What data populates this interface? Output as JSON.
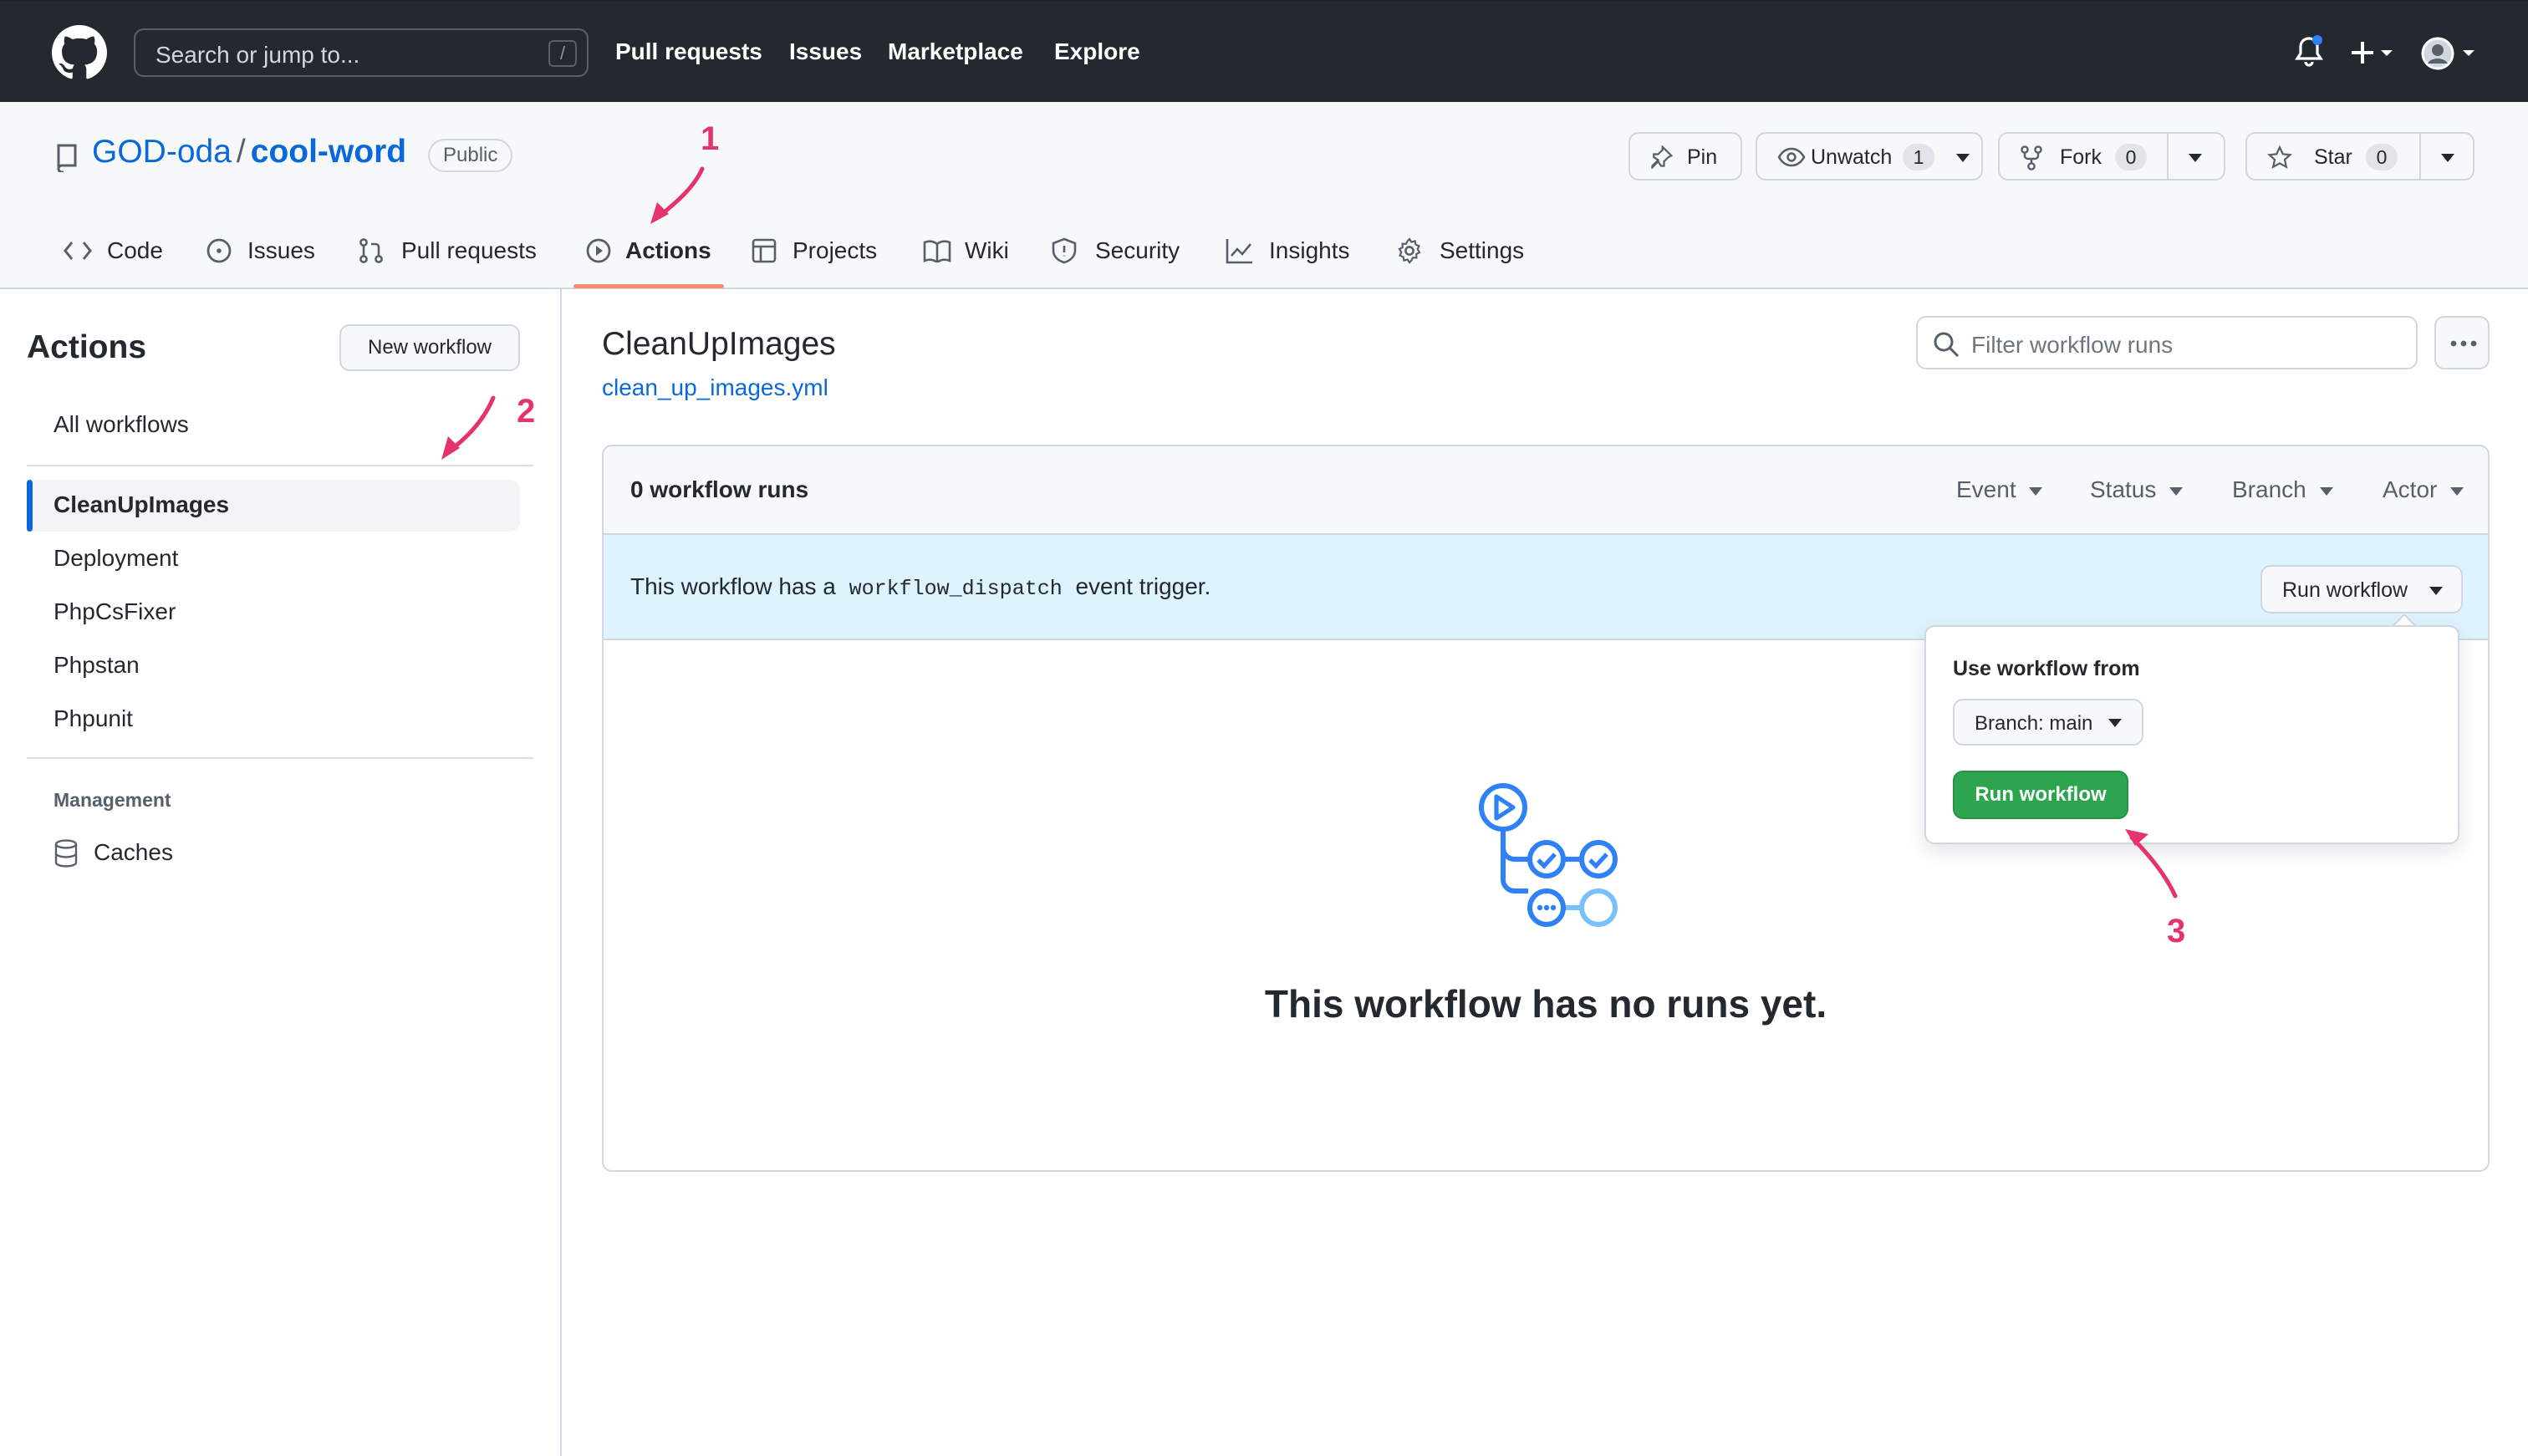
{
  "header": {
    "search_placeholder": "Search or jump to...",
    "search_shortcut": "/",
    "nav": [
      "Pull requests",
      "Issues",
      "Marketplace",
      "Explore"
    ]
  },
  "repo": {
    "owner": "GOD-oda",
    "separator": "/",
    "name": "cool-word",
    "visibility": "Public",
    "pin_label": "Pin",
    "unwatch_label": "Unwatch",
    "unwatch_count": "1",
    "fork_label": "Fork",
    "fork_count": "0",
    "star_label": "Star",
    "star_count": "0",
    "tabs": [
      "Code",
      "Issues",
      "Pull requests",
      "Actions",
      "Projects",
      "Wiki",
      "Security",
      "Insights",
      "Settings"
    ],
    "active_tab": "Actions"
  },
  "sidebar": {
    "title": "Actions",
    "new_workflow": "New workflow",
    "all_workflows": "All workflows",
    "workflows": [
      "CleanUpImages",
      "Deployment",
      "PhpCsFixer",
      "Phpstan",
      "Phpunit"
    ],
    "active_workflow": "CleanUpImages",
    "section": "Management",
    "management_items": [
      "Caches"
    ]
  },
  "main": {
    "title": "CleanUpImages",
    "file": "clean_up_images.yml",
    "filter_placeholder": "Filter workflow runs",
    "runs_count": "0 workflow runs",
    "filters": [
      "Event",
      "Status",
      "Branch",
      "Actor"
    ],
    "dispatch_prefix": "This workflow has a",
    "dispatch_code": "workflow_dispatch",
    "dispatch_suffix": "event trigger.",
    "run_workflow": "Run workflow",
    "empty": "This workflow has no runs yet."
  },
  "popover": {
    "label": "Use workflow from",
    "branch": "Branch: main",
    "submit": "Run workflow"
  },
  "annotations": [
    "1",
    "2",
    "3"
  ],
  "colors": {
    "header_bg": "#24292f",
    "link": "#0969da",
    "active_tab_underline": "#fd8c73",
    "dispatch_bg": "#ddf4ff",
    "primary_btn": "#2da44e",
    "annotation": "#e5336e"
  }
}
